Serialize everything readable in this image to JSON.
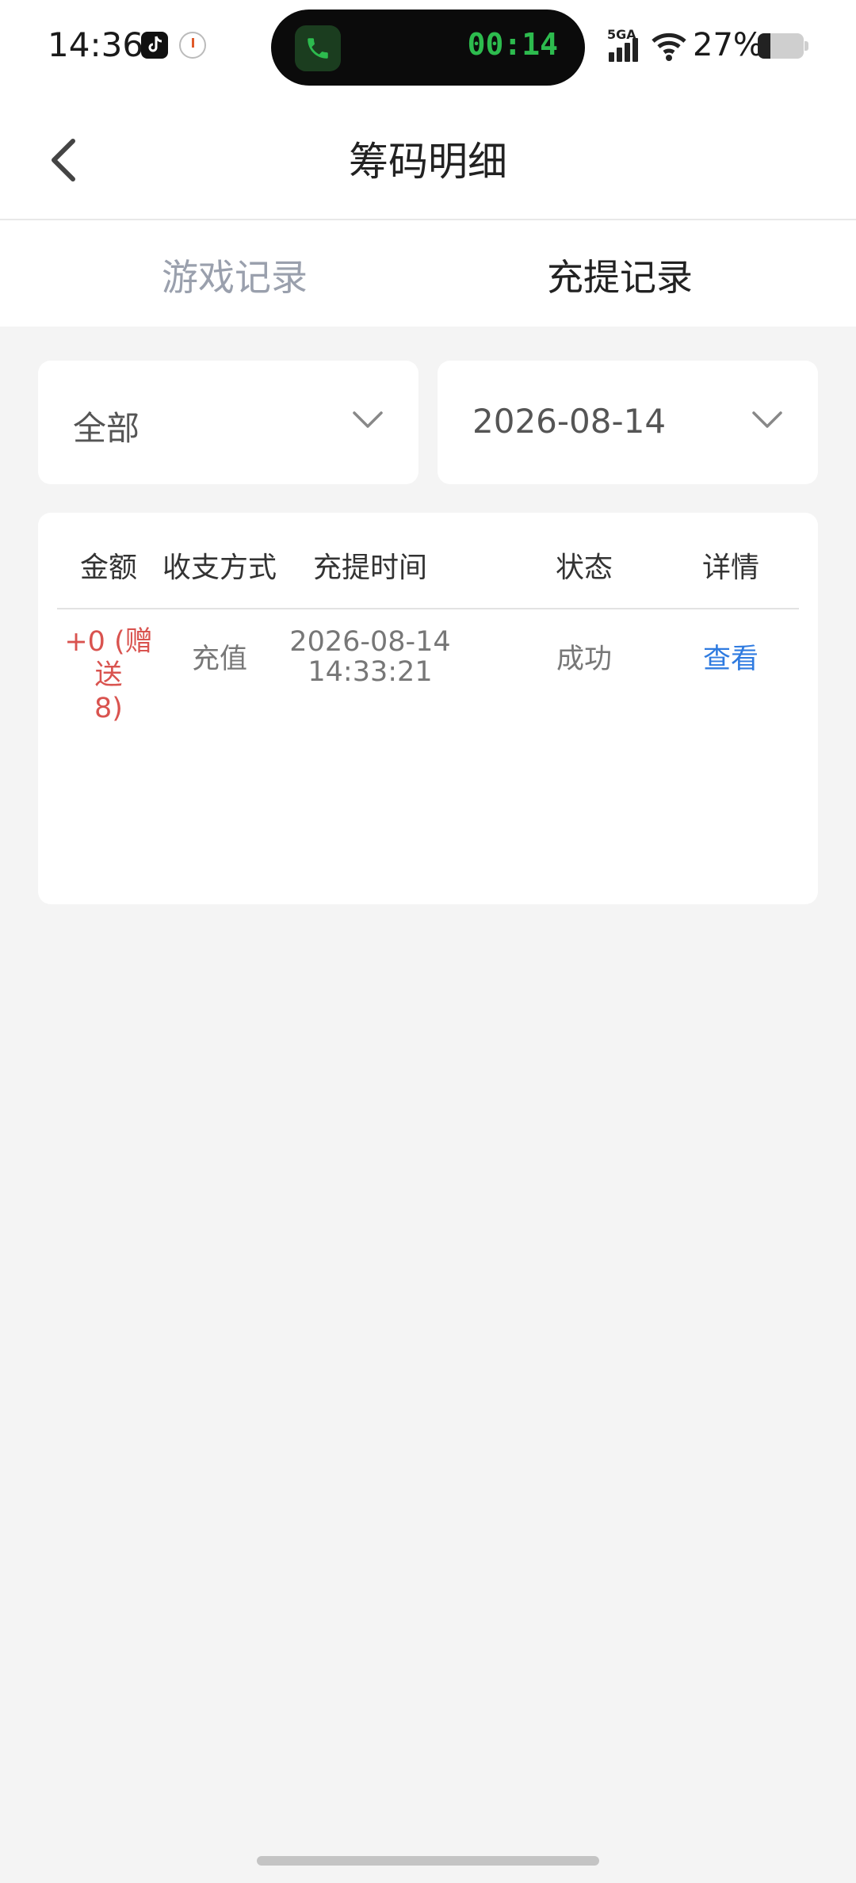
{
  "status_bar": {
    "time": "14:36",
    "call_timer": "00:14",
    "network_label": "5GA",
    "battery_percent": "27%",
    "battery_level": 0.27,
    "icons": [
      "tiktok-icon",
      "clock-icon",
      "phone-call-icon",
      "signal-icon",
      "wifi-icon",
      "battery-icon"
    ]
  },
  "header": {
    "title": "筹码明细",
    "back_icon": "chevron-left-icon"
  },
  "tabs": [
    {
      "label": "游戏记录",
      "active": false
    },
    {
      "label": "充提记录",
      "active": true
    }
  ],
  "filters": {
    "type_value": "全部",
    "date_value": "2026-08-14",
    "dropdown_icon": "chevron-down-icon"
  },
  "table": {
    "headers": [
      "金额",
      "收支方式",
      "充提时间",
      "状态",
      "详情"
    ],
    "rows": [
      {
        "amount_line1": "+0 (赠送",
        "amount_line2": "8)",
        "method": "充值",
        "date": "2026-08-14",
        "time": "14:33:21",
        "status": "成功",
        "detail": "查看"
      }
    ]
  },
  "colors": {
    "background": "#f4f4f4",
    "amount": "#d9534f",
    "link": "#2f7be0",
    "inactive_tab": "#9aa0ad",
    "call_green": "#2dbb4e"
  }
}
